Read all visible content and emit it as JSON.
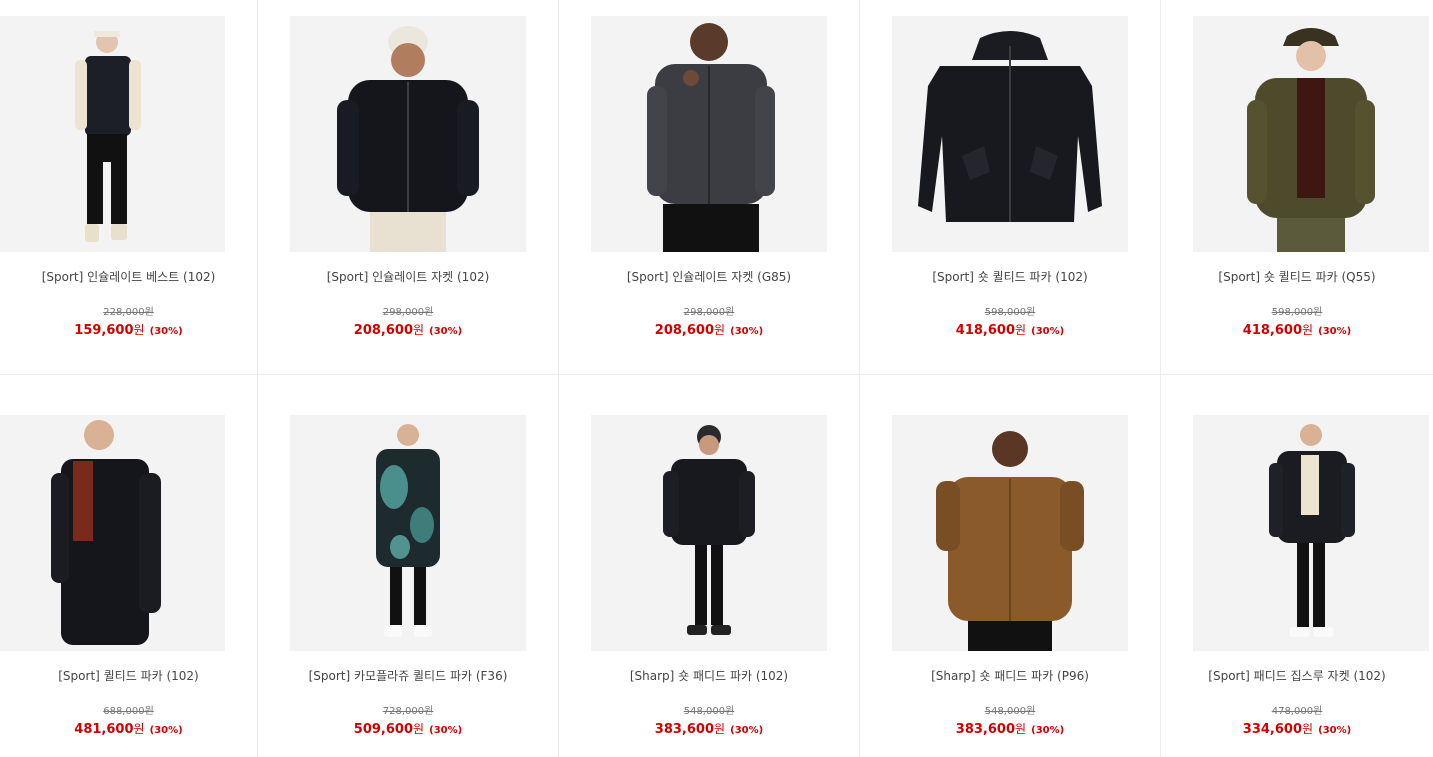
{
  "products": [
    {
      "name": "[Sport] 인슐레이트 베스트 (102)",
      "original_price": "228,000원",
      "sale_price": "159,600",
      "currency": "원",
      "discount": "(30%)",
      "image": "model-black-vest-cream-sleeves"
    },
    {
      "name": "[Sport] 인슐레이트 자켓 (102)",
      "original_price": "298,000원",
      "sale_price": "208,600",
      "currency": "원",
      "discount": "(30%)",
      "image": "model-black-puffer-jacket-beanie"
    },
    {
      "name": "[Sport] 인슐레이트 자켓 (G85)",
      "original_price": "298,000원",
      "sale_price": "208,600",
      "currency": "원",
      "discount": "(30%)",
      "image": "model-grey-puffer-jacket"
    },
    {
      "name": "[Sport] 숏 퀼티드 파카 (102)",
      "original_price": "598,000원",
      "sale_price": "418,600",
      "currency": "원",
      "discount": "(30%)",
      "image": "black-hooded-parka-flatlay"
    },
    {
      "name": "[Sport] 숏 퀼티드 파카 (Q55)",
      "original_price": "598,000원",
      "sale_price": "418,600",
      "currency": "원",
      "discount": "(30%)",
      "image": "model-olive-puffer-bucket-hat"
    },
    {
      "name": "[Sport] 퀼티드 파카 (102)",
      "original_price": "688,000원",
      "sale_price": "481,600",
      "currency": "원",
      "discount": "(30%)",
      "image": "model-black-long-parka"
    },
    {
      "name": "[Sport] 카모플라쥬 퀼티드 파카 (F36)",
      "original_price": "728,000원",
      "sale_price": "509,600",
      "currency": "원",
      "discount": "(30%)",
      "image": "model-camo-long-parka"
    },
    {
      "name": "[Sharp] 숏 패디드 파카 (102)",
      "original_price": "548,000원",
      "sale_price": "383,600",
      "currency": "원",
      "discount": "(30%)",
      "image": "model-black-padded-parka"
    },
    {
      "name": "[Sharp] 숏 패디드 파카 (P96)",
      "original_price": "548,000원",
      "sale_price": "383,600",
      "currency": "원",
      "discount": "(30%)",
      "image": "model-brown-padded-parka"
    },
    {
      "name": "[Sport] 패디드 집스루 자켓 (102)",
      "original_price": "478,000원",
      "sale_price": "334,600",
      "currency": "원",
      "discount": "(30%)",
      "image": "model-black-zip-through-jacket"
    }
  ],
  "colors": {
    "sale": "#d40000",
    "thumbnail_background": "#f3f3f3",
    "divider": "#ececec"
  }
}
